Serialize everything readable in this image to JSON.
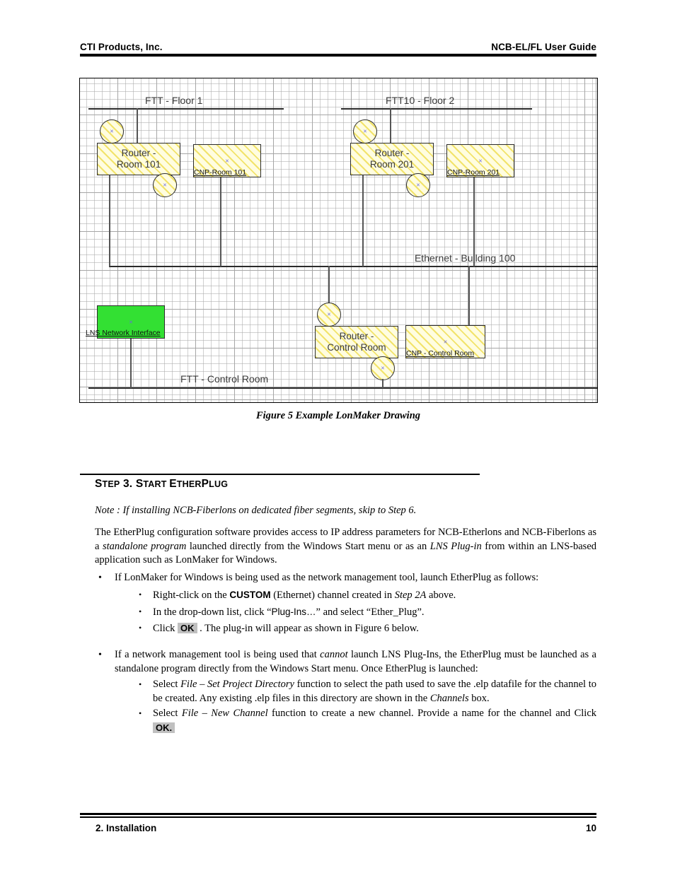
{
  "header": {
    "left": "CTI Products, Inc.",
    "right": "NCB-EL/FL User Guide"
  },
  "figure": {
    "caption": "Figure 5  Example LonMaker Drawing",
    "bus_labels": {
      "ftt_floor1": "FTT - Floor 1",
      "ftt10_floor2": "FTT10 - Floor 2",
      "ethernet_building": "Ethernet - Building 100",
      "ftt_control_room": "FTT - Control Room"
    },
    "nodes": {
      "router_room101": "Router -\nRoom 101",
      "router_room201": "Router -\nRoom 201",
      "router_control_room": "Router -\nControl Room",
      "cnp_room101": "CNP-Room 101",
      "cnp_room201": "CNP-Room 201",
      "cnp_control_room": "CNP - Control Room",
      "lns_network_interface": "LNS Network Interface"
    },
    "glyph": "×",
    "colors": {
      "node_fill": "#fffde0",
      "node_hatch": "#f2e36a",
      "lns_fill": "#33e033",
      "line": "#2b2b2b",
      "x_mark": "#6a6ae0"
    }
  },
  "section": {
    "heading_parts": {
      "s1": "S",
      "w1": "TEP",
      "num": " 3.  ",
      "s2": "S",
      "w2": "TART ",
      "s3": "E",
      "w3": "THER",
      "s4": "P",
      "w4": "LUG"
    },
    "heading_plain": "STEP 3.  START ETHERPLUG"
  },
  "body": {
    "note": "Note : If installing NCB-Fiberlons on dedicated fiber segments, skip to Step 6.",
    "paragraph1_a": "The EtherPlug configuration software provides access to IP address parameters for NCB-Etherlons and NCB-Fiberlons as a ",
    "paragraph1_em1": "standalone program",
    "paragraph1_b": " launched directly from the Windows Start menu or as an ",
    "paragraph1_em2": "LNS Plug-in",
    "paragraph1_c": " from within an LNS-based application such as LonMaker for Windows.",
    "bullet1": "If LonMaker for Windows is being used as the network management tool, launch EtherPlug as follows:",
    "sub1_a": "Right-click on the ",
    "sub1_bold": "CUSTOM",
    "sub1_b": " (Ethernet) channel created in ",
    "sub1_em": "Step 2A",
    "sub1_c": " above.",
    "sub2_a": "In the drop-down list, click “",
    "sub2_sans": "Plug-Ins…",
    "sub2_b": "” and select “Ether_Plug”.",
    "sub3_a": "Click ",
    "sub3_btn": "OK",
    "sub3_b": " .  The plug-in will appear as shown in Figure 6 below.",
    "bullet2_a": "If a network management tool is being used that ",
    "bullet2_em": "cannot",
    "bullet2_b": " launch LNS Plug-Ins, the EtherPlug must be launched as a standalone program directly from the Windows Start menu.  Once EtherPlug is launched:",
    "sub4_a": "Select ",
    "sub4_em1": "File – Set Project Directory",
    "sub4_b": " function to select the path used to save the .elp datafile for the channel to be created.  Any existing .elp files in this directory are shown in the ",
    "sub4_em2": "Channels",
    "sub4_c": " box.",
    "sub5_a": "Select ",
    "sub5_em1": "File – New Channel",
    "sub5_b": " function to create a new channel.  Provide a name for the channel and Click ",
    "sub5_btn": "OK.",
    "sub5_c": ""
  },
  "footer": {
    "left": "2. Installation",
    "page": "10"
  }
}
